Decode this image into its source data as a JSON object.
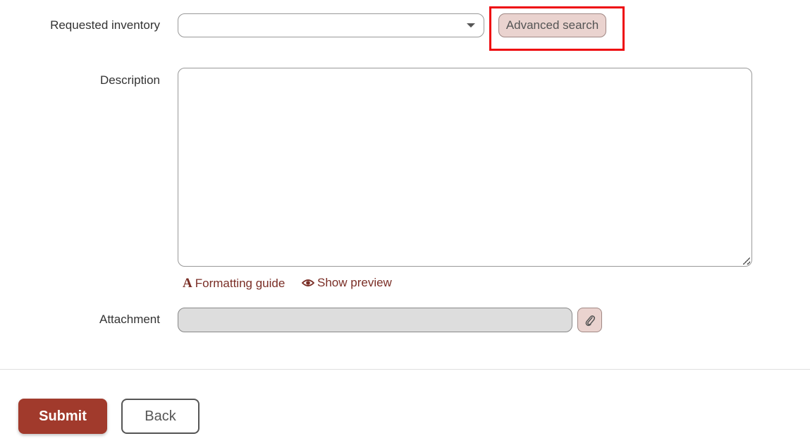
{
  "form": {
    "requested_inventory_label": "Requested inventory",
    "requested_inventory_value": "",
    "advanced_search_label": "Advanced search",
    "description_label": "Description",
    "description_value": "",
    "formatting_guide_label": "Formatting guide",
    "show_preview_label": "Show preview",
    "attachment_label": "Attachment",
    "attachment_value": ""
  },
  "actions": {
    "submit_label": "Submit",
    "back_label": "Back"
  },
  "icons": {
    "select_caret": "chevron-down-icon",
    "formatting": "font-icon",
    "preview": "eye-icon",
    "attachment": "paperclip-icon"
  },
  "colors": {
    "accent": "#a13a2c",
    "link": "#7a2e26",
    "highlight": "#ee0a10",
    "button_bg": "#ead3cf"
  }
}
